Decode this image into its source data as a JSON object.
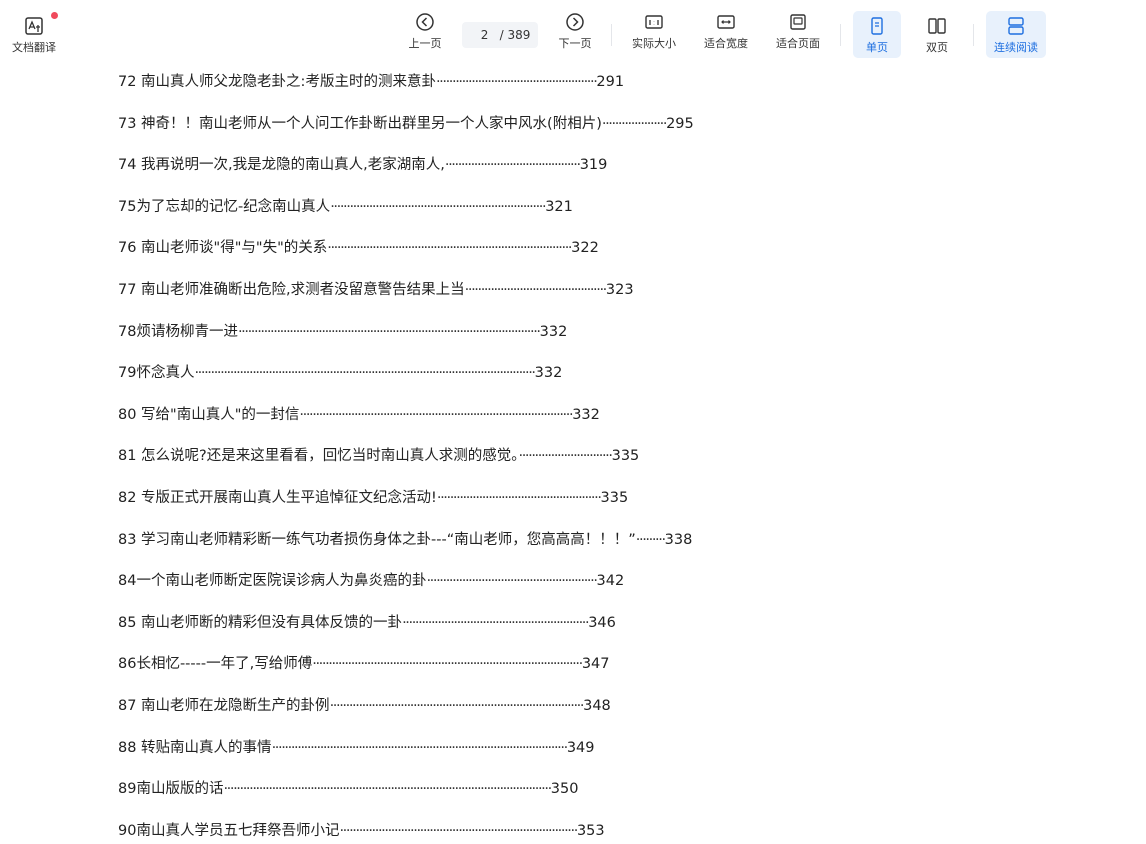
{
  "toolbar": {
    "translate_label": "文档翻译",
    "prev_label": "上一页",
    "current_page": "2",
    "page_total": "/ 389",
    "next_label": "下一页",
    "actual_size_label": "实际大小",
    "fit_width_label": "适合宽度",
    "fit_page_label": "适合页面",
    "single_page_label": "单页",
    "double_page_label": "双页",
    "continuous_label": "连续阅读"
  },
  "toc": [
    {
      "title": "72 南山真人师父龙隐老卦之:考版主时的测来意卦",
      "dots": 50,
      "page": "291"
    },
    {
      "title": "73 神奇！！南山老师从一个人问工作卦断出群里另一个人家中风水(附相片)",
      "dots": 20,
      "page": "295"
    },
    {
      "title": "74 我再说明一次,我是龙隐的南山真人,老家湖南人,",
      "dots": 42,
      "page": "319"
    },
    {
      "title": "75为了忘却的记忆-纪念南山真人",
      "dots": 67,
      "page": "321"
    },
    {
      "title": "76 南山老师谈\"得\"与\"失\"的关系",
      "dots": 76,
      "page": "322"
    },
    {
      "title": "77 南山老师准确断出危险,求测者没留意警告结果上当",
      "dots": 44,
      "page": "323"
    },
    {
      "title": "78烦请杨柳青一进",
      "dots": 94,
      "page": "332"
    },
    {
      "title": "79怀念真人",
      "dots": 106,
      "page": "332"
    },
    {
      "title": "80 写给\"南山真人\"的一封信",
      "dots": 85,
      "page": "332"
    },
    {
      "title": "81 怎么说呢?还是来这里看看，回忆当时南山真人求测的感觉。",
      "dots": 29,
      "page": "335"
    },
    {
      "title": "82 专版正式开展南山真人生平追悼征文纪念活动!",
      "dots": 51,
      "page": "335"
    },
    {
      "title": "83 学习南山老师精彩断一练气功者损伤身体之卦---“南山老师，您高高高！！！”",
      "dots": 9,
      "page": "338"
    },
    {
      "title": "84一个南山老师断定医院误诊病人为鼻炎癌的卦",
      "dots": 53,
      "page": "342"
    },
    {
      "title": "85 南山老师断的精彩但没有具体反馈的一卦",
      "dots": 58,
      "page": "346"
    },
    {
      "title": "86长相忆-----一年了,写给师傅",
      "dots": 84,
      "page": "347"
    },
    {
      "title": "87 南山老师在龙隐断生产的卦例",
      "dots": 79,
      "page": "348"
    },
    {
      "title": "88 转贴南山真人的事情",
      "dots": 92,
      "page": "349"
    },
    {
      "title": "89南山版版的话",
      "dots": 102,
      "page": "350"
    },
    {
      "title": "90南山真人学员五七拜祭吾师小记",
      "dots": 74,
      "page": "353"
    }
  ]
}
